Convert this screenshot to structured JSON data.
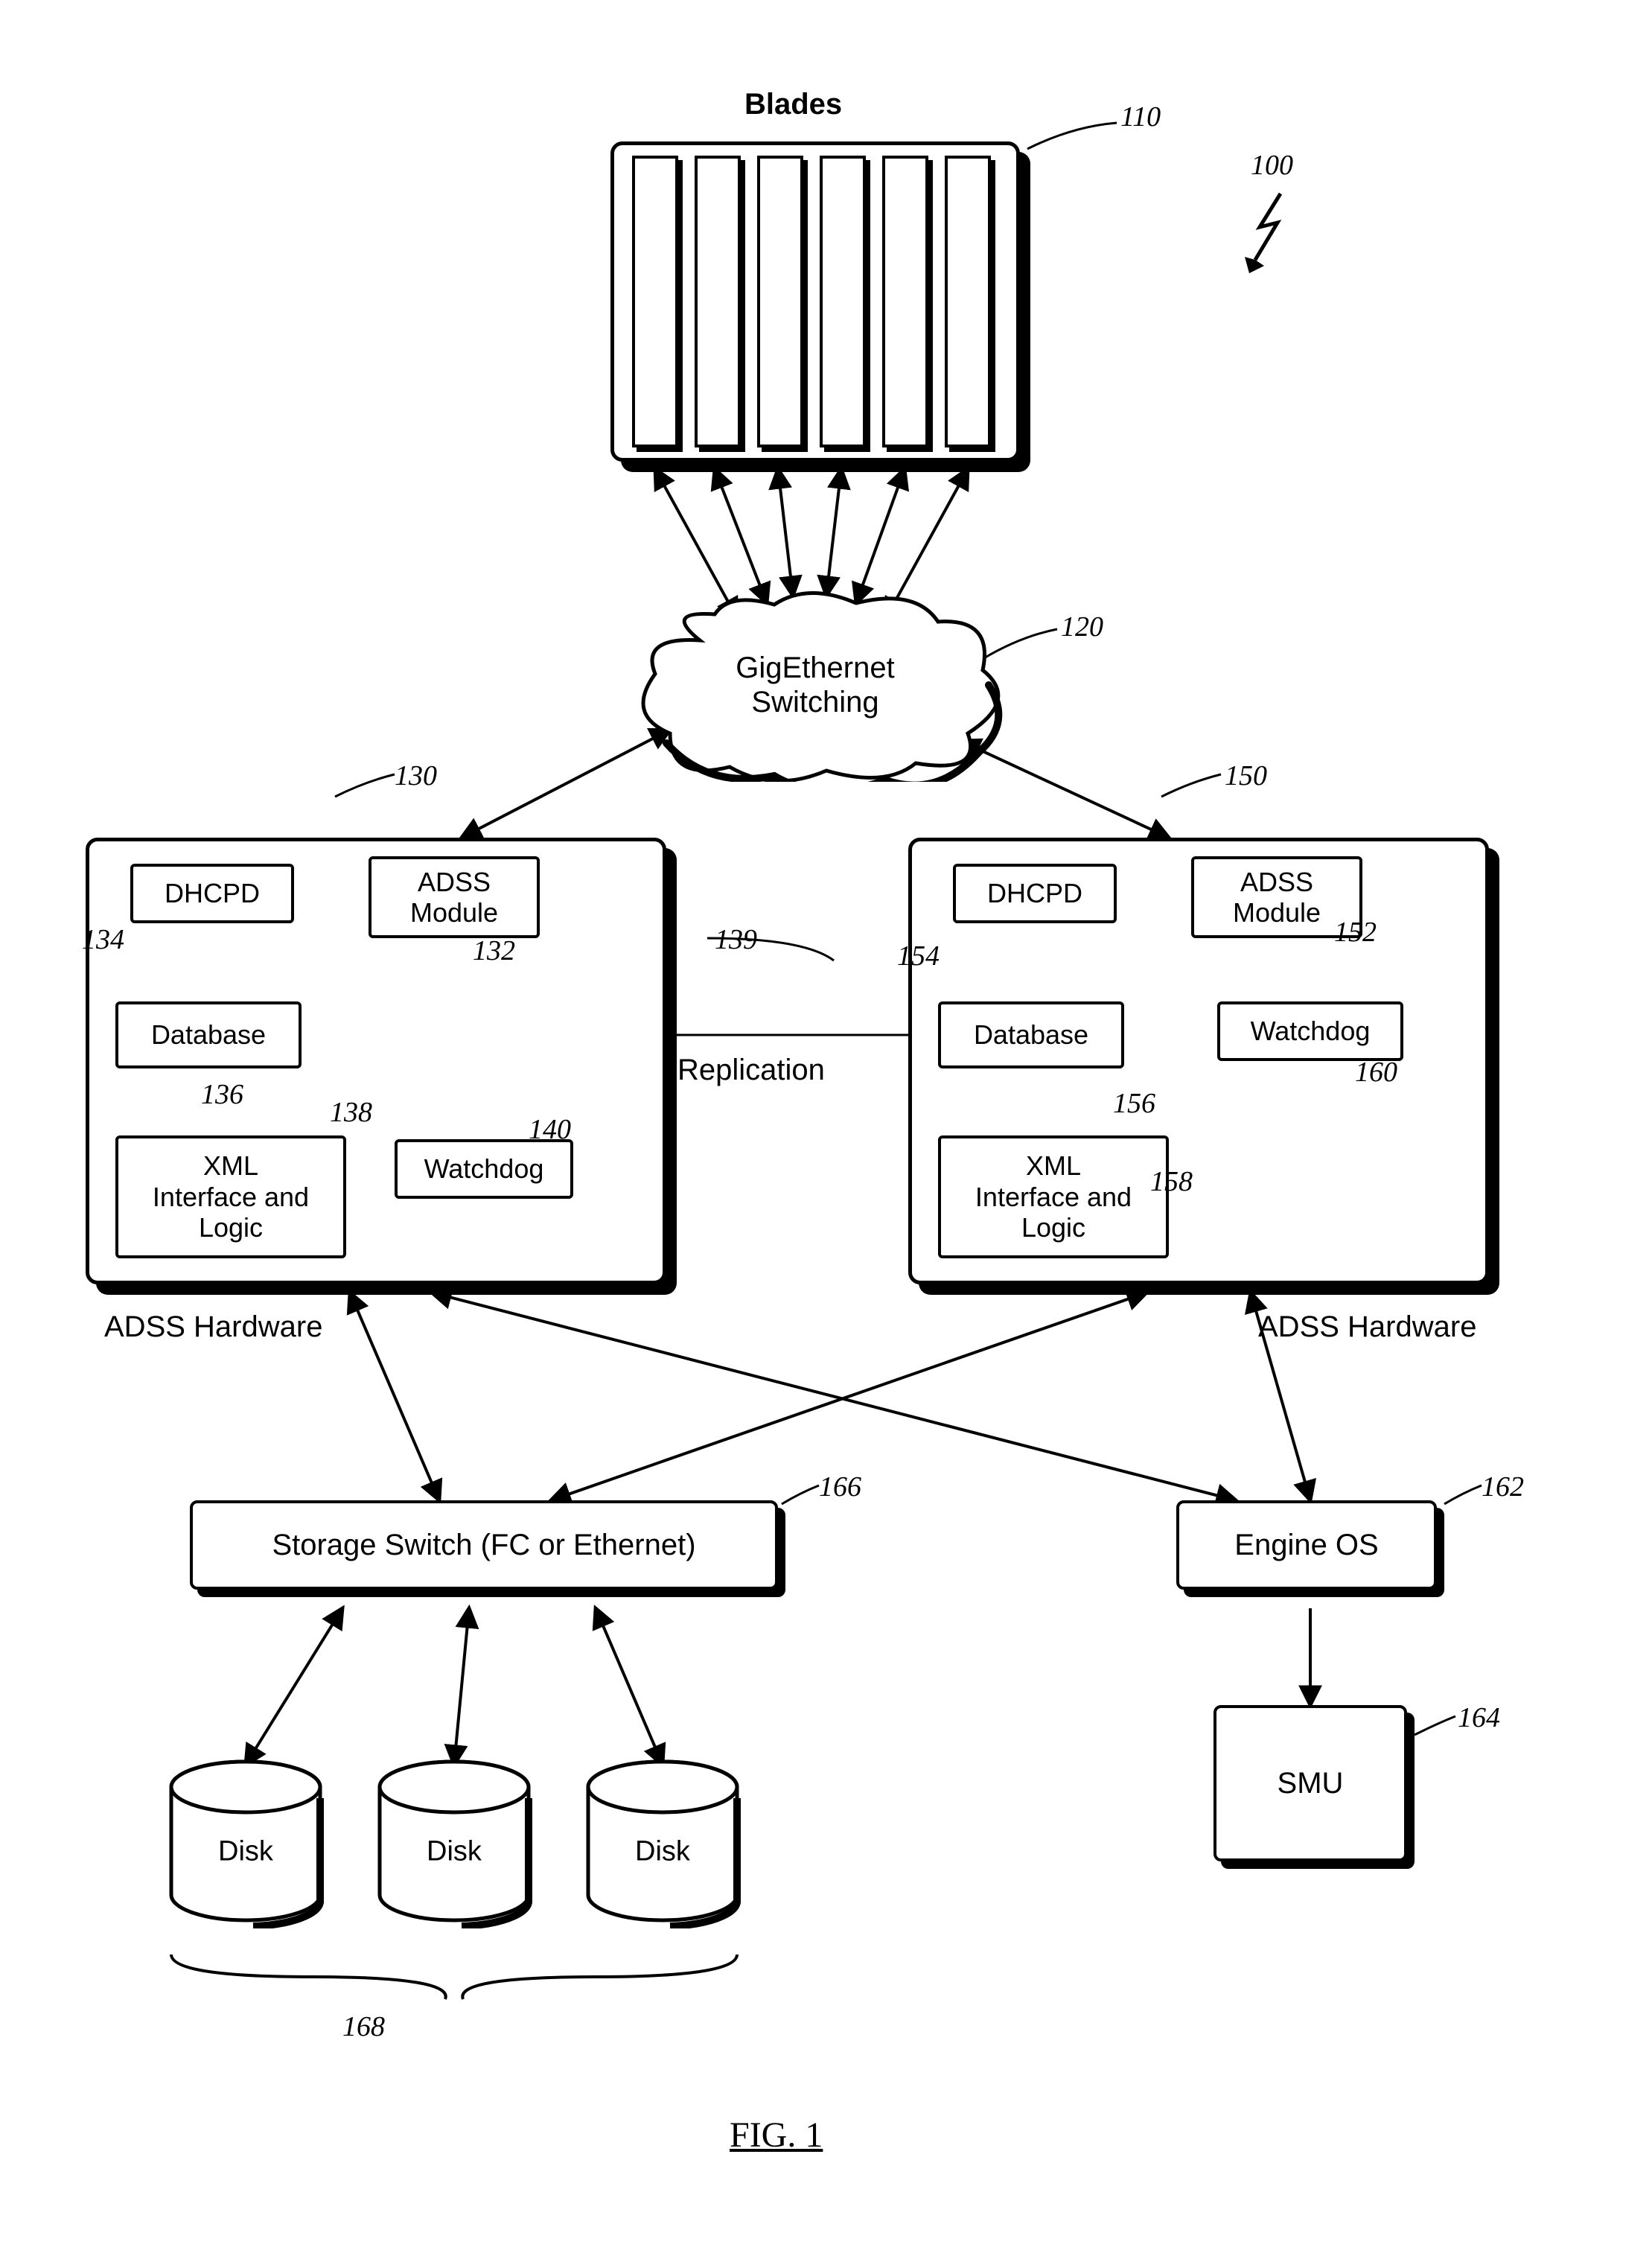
{
  "figure_caption": "FIG. 1",
  "refs": {
    "r100": "100",
    "r110": "110",
    "r120": "120",
    "r130": "130",
    "r132": "132",
    "r134": "134",
    "r136": "136",
    "r138": "138",
    "r139": "139",
    "r140": "140",
    "r150": "150",
    "r152": "152",
    "r154": "154",
    "r156": "156",
    "r158": "158",
    "r160": "160",
    "r162": "162",
    "r164": "164",
    "r166": "166",
    "r168": "168"
  },
  "blocks": {
    "blades_title": "Blades",
    "cloud": "GigEthernet\nSwitching",
    "adss_hw": "ADSS Hardware",
    "dhcpd": "DHCPD",
    "adss_module": "ADSS\nModule",
    "database": "Database",
    "watchdog": "Watchdog",
    "xml": "XML\nInterface and\nLogic",
    "replication": "Replication",
    "storage_switch": "Storage Switch (FC or Ethernet)",
    "engine_os": "Engine OS",
    "smu": "SMU",
    "disk": "Disk"
  },
  "chart_data": {
    "type": "diagram",
    "title": "FIG. 1",
    "nodes": [
      {
        "id": "blades",
        "ref": "110",
        "label": "Blades"
      },
      {
        "id": "gige",
        "ref": "120",
        "label": "GigEthernet Switching"
      },
      {
        "id": "adss_left",
        "ref": "130",
        "label": "ADSS Hardware",
        "children": [
          {
            "id": "dhcpd_l",
            "ref": "134",
            "label": "DHCPD"
          },
          {
            "id": "adssmod_l",
            "ref": "132",
            "label": "ADSS Module"
          },
          {
            "id": "db_l",
            "ref": "136",
            "label": "Database"
          },
          {
            "id": "xml_l",
            "ref": "138",
            "label": "XML Interface and Logic"
          },
          {
            "id": "watchdog_l",
            "ref": "140",
            "label": "Watchdog"
          }
        ]
      },
      {
        "id": "adss_right",
        "ref": "150",
        "label": "ADSS Hardware",
        "children": [
          {
            "id": "dhcpd_r",
            "ref": "154",
            "label": "DHCPD"
          },
          {
            "id": "adssmod_r",
            "ref": "152",
            "label": "ADSS Module"
          },
          {
            "id": "db_r",
            "ref": "156",
            "label": "Database"
          },
          {
            "id": "xml_r",
            "ref": "158",
            "label": "XML Interface and Logic"
          },
          {
            "id": "watchdog_r",
            "ref": "160",
            "label": "Watchdog"
          }
        ]
      },
      {
        "id": "storage_switch",
        "ref": "166",
        "label": "Storage Switch (FC or Ethernet)"
      },
      {
        "id": "engine_os",
        "ref": "162",
        "label": "Engine OS"
      },
      {
        "id": "smu",
        "ref": "164",
        "label": "SMU"
      },
      {
        "id": "disks",
        "ref": "168",
        "label": "Disk",
        "count": 3
      }
    ],
    "edges": [
      {
        "from": "blades",
        "to": "gige",
        "dir": "both",
        "fanout": 6
      },
      {
        "from": "gige",
        "to": "adss_left",
        "dir": "both"
      },
      {
        "from": "gige",
        "to": "adss_right",
        "dir": "both"
      },
      {
        "from": "dhcpd_l",
        "to": "db_l",
        "dir": "both"
      },
      {
        "from": "db_l",
        "to": "adssmod_l",
        "dir": "both"
      },
      {
        "from": "db_l",
        "to": "xml_l",
        "dir": "both"
      },
      {
        "from": "db_l",
        "to": "db_r",
        "dir": "both",
        "ref": "139",
        "label": "Replication"
      },
      {
        "from": "db_r",
        "to": "dhcpd_r",
        "dir": "to"
      },
      {
        "from": "db_r",
        "to": "adssmod_r",
        "dir": "to"
      },
      {
        "from": "db_r",
        "to": "xml_r",
        "dir": "to"
      },
      {
        "from": "adss_left",
        "to": "storage_switch",
        "dir": "both"
      },
      {
        "from": "adss_left",
        "to": "engine_os",
        "dir": "both"
      },
      {
        "from": "adss_right",
        "to": "storage_switch",
        "dir": "both"
      },
      {
        "from": "adss_right",
        "to": "engine_os",
        "dir": "both"
      },
      {
        "from": "storage_switch",
        "to": "disks",
        "dir": "both",
        "fanout": 3
      },
      {
        "from": "engine_os",
        "to": "smu",
        "dir": "to"
      }
    ],
    "system_ref": "100"
  }
}
